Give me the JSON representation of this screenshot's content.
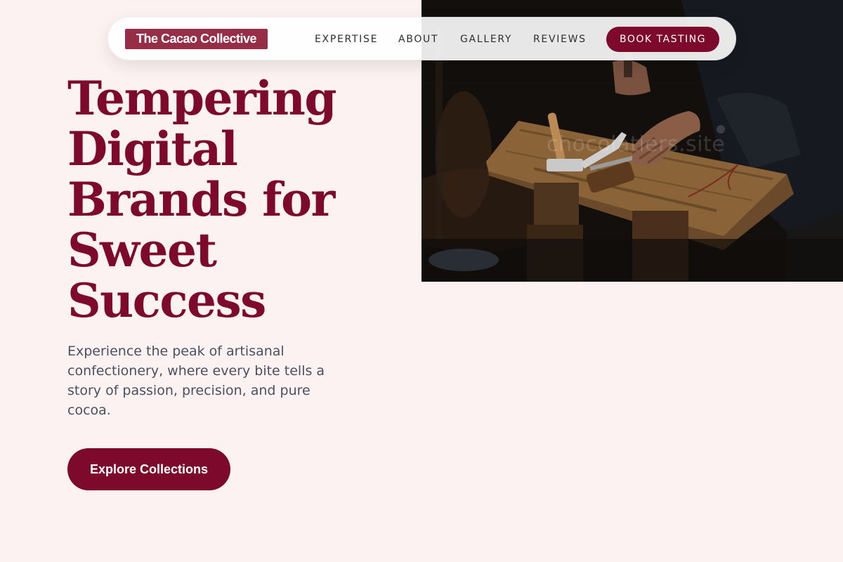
{
  "brand": {
    "name": "The Cacao Collective"
  },
  "nav": {
    "links": [
      "EXPERTISE",
      "ABOUT",
      "GALLERY",
      "REVIEWS"
    ],
    "cta_label": "BOOK TASTING"
  },
  "hero": {
    "headline_lines": [
      "Tempering",
      "Digital",
      "Brands for",
      "Sweet",
      "Success"
    ],
    "subtext": "Experience the peak of artisanal confectionery, where every bite tells a story of passion, precision, and pure cocoa.",
    "cta_label": "Explore Collections",
    "image_watermark": "chocolatiers.site",
    "image_description": "craftsman-hands-with-tools-on-wooden-board"
  },
  "colors": {
    "page_background": "#fdf2f2",
    "accent": "#7d0a2c",
    "brand_badge": "#962e48",
    "body_text": "#4a5060"
  }
}
